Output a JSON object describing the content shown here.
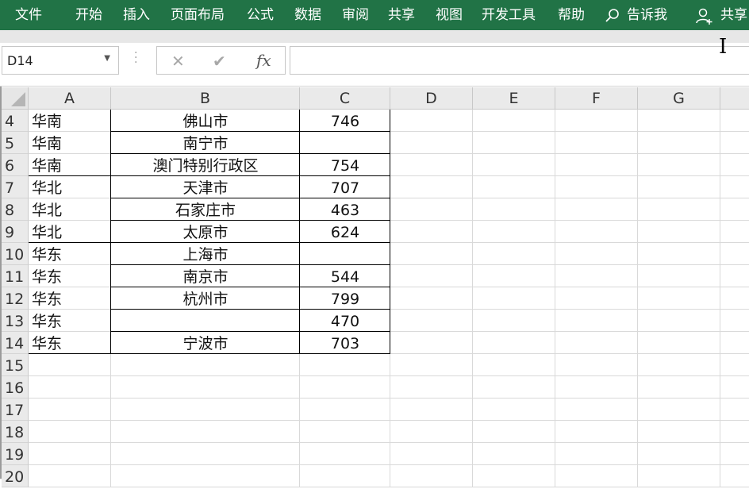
{
  "ribbon": {
    "tabs": [
      {
        "label": "文件",
        "name": "tab-file"
      },
      {
        "label": "开始",
        "name": "tab-home"
      },
      {
        "label": "插入",
        "name": "tab-insert"
      },
      {
        "label": "页面布局",
        "name": "tab-page-layout"
      },
      {
        "label": "公式",
        "name": "tab-formulas"
      },
      {
        "label": "数据",
        "name": "tab-data"
      },
      {
        "label": "审阅",
        "name": "tab-review"
      },
      {
        "label": "共享",
        "name": "tab-share-menu"
      },
      {
        "label": "视图",
        "name": "tab-view"
      },
      {
        "label": "开发工具",
        "name": "tab-developer"
      },
      {
        "label": "帮助",
        "name": "tab-help"
      }
    ],
    "tell_me": {
      "label": "告诉我",
      "icon": "search-icon"
    },
    "share": {
      "label": "共享",
      "icon": "user-add-icon"
    },
    "background_color": "#217346"
  },
  "formula_bar": {
    "name_box": "D14",
    "cancel_icon": "close-icon",
    "enter_icon": "check-icon",
    "fx_label": "fx",
    "formula": ""
  },
  "sheet": {
    "columns": [
      "A",
      "B",
      "C",
      "D",
      "E",
      "F",
      "G"
    ],
    "rows": [
      {
        "num": "4",
        "a": "华南",
        "b": "佛山市",
        "c": "746"
      },
      {
        "num": "5",
        "a": "华南",
        "b": "南宁市",
        "c": ""
      },
      {
        "num": "6",
        "a": "华南",
        "b": "澳门特别行政区",
        "c": "754"
      },
      {
        "num": "7",
        "a": "华北",
        "b": "天津市",
        "c": "707"
      },
      {
        "num": "8",
        "a": "华北",
        "b": "石家庄市",
        "c": "463"
      },
      {
        "num": "9",
        "a": "华北",
        "b": "太原市",
        "c": "624"
      },
      {
        "num": "10",
        "a": "华东",
        "b": "上海市",
        "c": ""
      },
      {
        "num": "11",
        "a": "华东",
        "b": "南京市",
        "c": "544"
      },
      {
        "num": "12",
        "a": "华东",
        "b": "杭州市",
        "c": "799"
      },
      {
        "num": "13",
        "a": "华东",
        "b": "",
        "c": "470"
      },
      {
        "num": "14",
        "a": "华东",
        "b": "宁波市",
        "c": "703"
      },
      {
        "num": "15",
        "a": "",
        "b": "",
        "c": ""
      },
      {
        "num": "16",
        "a": "",
        "b": "",
        "c": ""
      },
      {
        "num": "17",
        "a": "",
        "b": "",
        "c": ""
      },
      {
        "num": "18",
        "a": "",
        "b": "",
        "c": ""
      },
      {
        "num": "19",
        "a": "",
        "b": "",
        "c": ""
      },
      {
        "num": "20",
        "a": "",
        "b": "",
        "c": ""
      }
    ]
  }
}
